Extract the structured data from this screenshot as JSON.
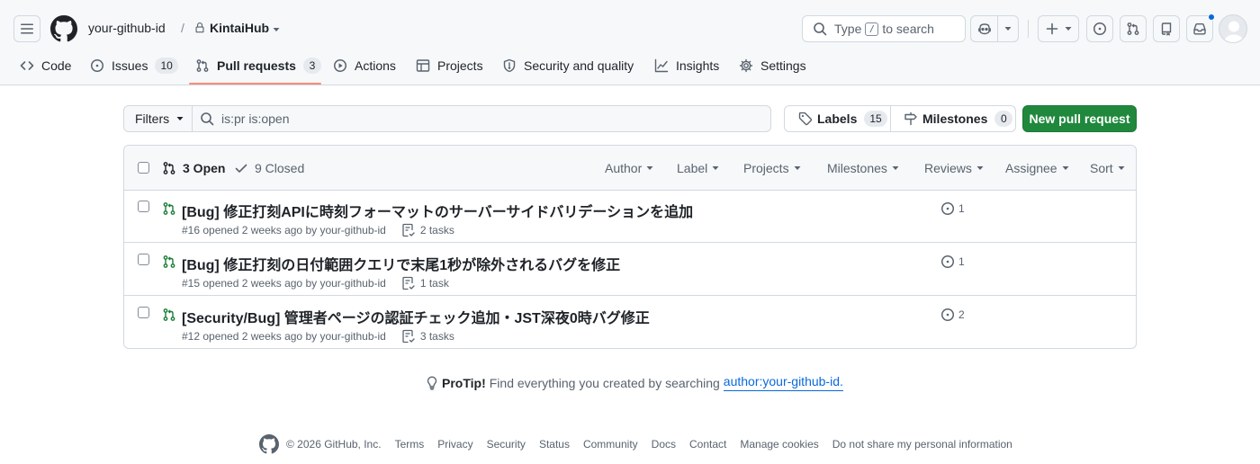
{
  "header": {
    "owner": "your-github-id",
    "separator": "/",
    "repo": "KintaiHub",
    "search_prefix": "Type",
    "search_key": "/",
    "search_suffix": "to search"
  },
  "nav": {
    "items": [
      {
        "label": "Code",
        "icon": "code-icon"
      },
      {
        "label": "Issues",
        "icon": "issue-opened-icon",
        "count": "10"
      },
      {
        "label": "Pull requests",
        "icon": "git-pull-request-icon",
        "count": "3",
        "selected": true
      },
      {
        "label": "Actions",
        "icon": "play-icon"
      },
      {
        "label": "Projects",
        "icon": "table-icon"
      },
      {
        "label": "Security and quality",
        "icon": "shield-icon"
      },
      {
        "label": "Insights",
        "icon": "graph-icon"
      },
      {
        "label": "Settings",
        "icon": "gear-icon"
      }
    ]
  },
  "subnav": {
    "filters_label": "Filters",
    "query": "is:pr is:open",
    "labels_label": "Labels",
    "labels_count": "15",
    "milestones_label": "Milestones",
    "milestones_count": "0",
    "new_pr_label": "New pull request"
  },
  "list": {
    "open_label": "3 Open",
    "closed_label": "9 Closed",
    "filters": [
      "Author",
      "Label",
      "Projects",
      "Milestones",
      "Reviews",
      "Assignee",
      "Sort"
    ],
    "rows": [
      {
        "title": "[Bug] 修正打刻APIに時刻フォーマットのサーバーサイドバリデーションを追加",
        "meta": "#16 opened 2 weeks ago by your-github-id",
        "tasks": "2 tasks",
        "linked_issues": "1"
      },
      {
        "title": "[Bug] 修正打刻の日付範囲クエリで末尾1秒が除外されるバグを修正",
        "meta": "#15 opened 2 weeks ago by your-github-id",
        "tasks": "1 task",
        "linked_issues": "1"
      },
      {
        "title": "[Security/Bug] 管理者ページの認証チェック追加・JST深夜0時バグ修正",
        "meta": "#12 opened 2 weeks ago by your-github-id",
        "tasks": "3 tasks",
        "linked_issues": "2"
      }
    ]
  },
  "protip": {
    "label": "ProTip!",
    "text": "Find everything you created by searching",
    "link": "author:your-github-id."
  },
  "footer": {
    "copyright": "© 2026 GitHub, Inc.",
    "links": [
      "Terms",
      "Privacy",
      "Security",
      "Status",
      "Community",
      "Docs",
      "Contact",
      "Manage cookies",
      "Do not share my personal information"
    ]
  },
  "colors": {
    "accent": "#0969da",
    "primary_button": "#1f883d",
    "open_state": "#1a7f37",
    "nav_underline": "#fd8c73"
  }
}
